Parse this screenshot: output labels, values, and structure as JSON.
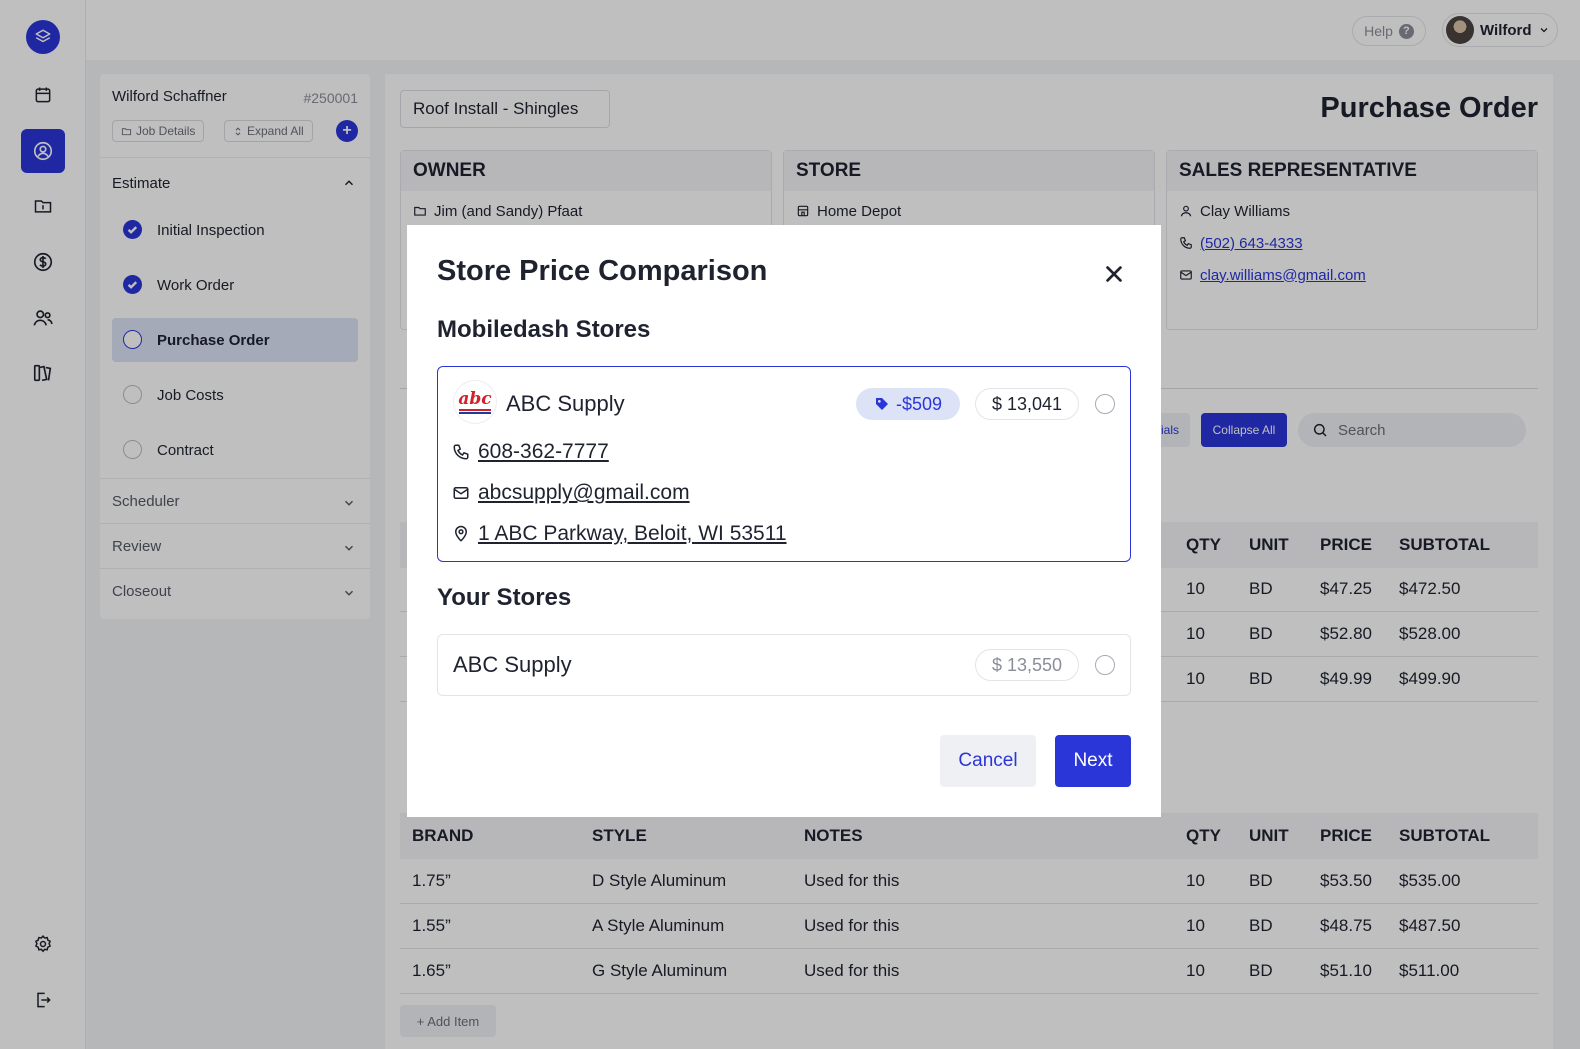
{
  "topbar": {
    "help_label": "Help",
    "help_glyph": "?",
    "user_name": "Wilford"
  },
  "sidepanel": {
    "client_name": "Wilford Schaffner",
    "job_number": "#250001",
    "job_details_label": "Job Details",
    "expand_all_label": "Expand All",
    "add_glyph": "+",
    "estimate_label": "Estimate",
    "steps": [
      {
        "label": "Initial Inspection",
        "status": "done"
      },
      {
        "label": "Work Order",
        "status": "done"
      },
      {
        "label": "Purchase Order",
        "status": "current"
      },
      {
        "label": "Job Costs",
        "status": "todo"
      },
      {
        "label": "Contract",
        "status": "todo"
      }
    ],
    "sections": [
      "Scheduler",
      "Review",
      "Closeout"
    ]
  },
  "main": {
    "job_title": "Roof Install - Shingles",
    "page_title": "Purchase Order",
    "owner": {
      "heading": "OWNER",
      "name": "Jim (and Sandy) Pfaat"
    },
    "store": {
      "heading": "STORE",
      "name": "Home Depot"
    },
    "sales_rep": {
      "heading": "SALES REPRESENTATIVE",
      "name": "Clay Williams",
      "phone": "(502) 643-4333",
      "email": "clay.williams@gmail.com"
    },
    "materials_partial": "ials",
    "collapse_all_label": "Collapse All",
    "search_placeholder": "Search",
    "table1": {
      "headers": [
        "QTY",
        "UNIT",
        "PRICE",
        "SUBTOTAL"
      ],
      "rows": [
        [
          "10",
          "BD",
          "$47.25",
          "$472.50"
        ],
        [
          "10",
          "BD",
          "$52.80",
          "$528.00"
        ],
        [
          "10",
          "BD",
          "$49.99",
          "$499.90"
        ]
      ]
    },
    "table2": {
      "headers": [
        "BRAND",
        "STYLE",
        "NOTES",
        "QTY",
        "UNIT",
        "PRICE",
        "SUBTOTAL"
      ],
      "rows": [
        [
          "1.75”",
          "D Style Aluminum",
          "Used for this",
          "10",
          "BD",
          "$53.50",
          "$535.00"
        ],
        [
          "1.55”",
          "A Style Aluminum",
          "Used for this",
          "10",
          "BD",
          "$48.75",
          "$487.50"
        ],
        [
          "1.65”",
          "G Style Aluminum",
          "Used for this",
          "10",
          "BD",
          "$51.10",
          "$511.00"
        ]
      ]
    },
    "add_item_label": "+ Add Item"
  },
  "modal": {
    "title": "Store Price Comparison",
    "mobiledash_heading": "Mobiledash Stores",
    "mobiledash_store": {
      "logo_text": "abc",
      "name": "ABC Supply",
      "savings": "-$509",
      "price": "$ 13,041",
      "phone": "608-362-7777",
      "email": "abcsupply@gmail.com",
      "address": "1 ABC Parkway, Beloit, WI  53511"
    },
    "your_heading": "Your Stores",
    "your_store": {
      "name": "ABC Supply",
      "price": "$ 13,550"
    },
    "cancel_label": "Cancel",
    "next_label": "Next"
  },
  "colors": {
    "accent": "#2a36d8",
    "accent_soft": "#dde3f6",
    "abc_red": "#d32029"
  }
}
